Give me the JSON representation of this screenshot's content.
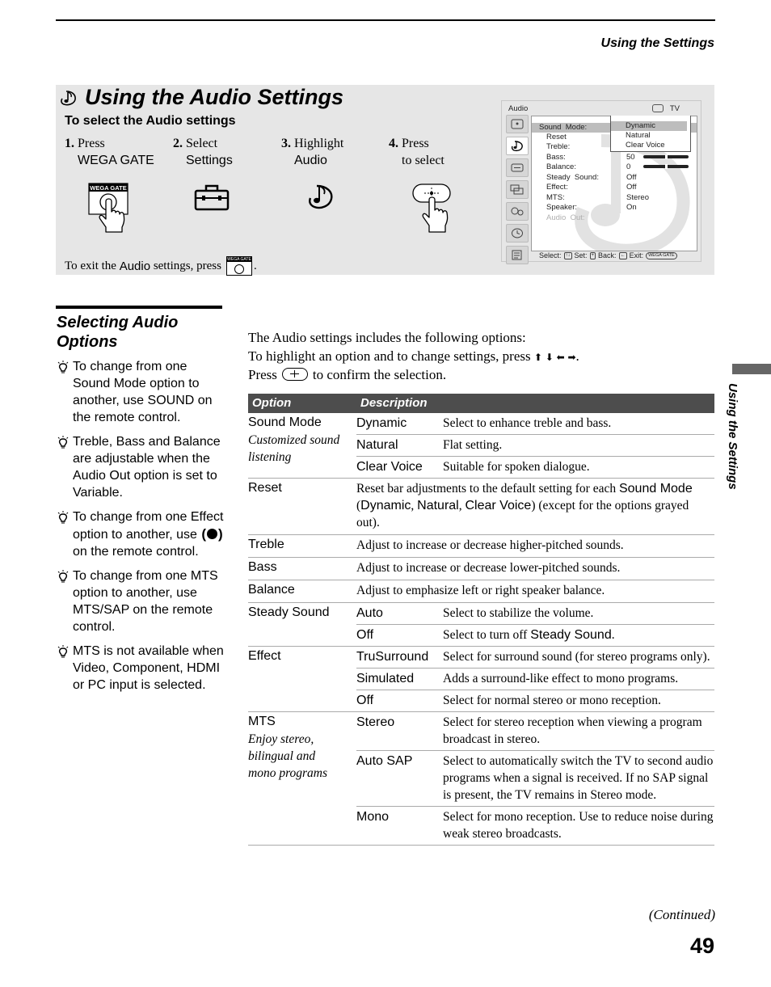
{
  "running_head": "Using the Settings",
  "side_tab_label": "Using the Settings",
  "hero": {
    "title": "Using the Audio Settings",
    "title_icon": "audio-note-icon",
    "subtitle": "To select the Audio settings",
    "steps": [
      {
        "num": "1.",
        "verb": "Press",
        "object": "WEGA GATE",
        "icon": "wega-gate-button-press-icon",
        "icon_label": "WEGA GATE"
      },
      {
        "num": "2.",
        "verb": "Select",
        "object": "Settings",
        "icon": "toolbox-icon"
      },
      {
        "num": "3.",
        "verb": "Highlight",
        "object": "Audio",
        "icon": "audio-note-icon"
      },
      {
        "num": "4.",
        "verb": "Press",
        "object": "to select",
        "icon": "select-button-press-icon"
      }
    ],
    "exit": {
      "prefix": "To exit the ",
      "word": "Audio",
      "suffix": " settings, press",
      "end": ".",
      "button_label": "WEGA GATE"
    }
  },
  "osd": {
    "header_label": "Audio",
    "input_label": "TV",
    "tabs": [
      "picture-icon",
      "audio-icon",
      "screen-icon",
      "channels-icon",
      "parent-icon",
      "timer-icon",
      "setup-icon"
    ],
    "active_tab": 1,
    "rows": [
      {
        "label": "Sound  Mode:",
        "value": ""
      },
      {
        "label": "Reset",
        "value": ""
      },
      {
        "label": "Treble:",
        "value": ""
      },
      {
        "label": "Bass:",
        "value": "50",
        "slider": 0.5
      },
      {
        "label": "Balance:",
        "value": "0",
        "slider": 0.5
      },
      {
        "label": "Steady  Sound:",
        "value": "Off"
      },
      {
        "label": "Effect:",
        "value": "Off"
      },
      {
        "label": "MTS:",
        "value": "Stereo"
      },
      {
        "label": "Speaker:",
        "value": "On"
      },
      {
        "label": "Audio  Out:",
        "value": "",
        "disabled": true
      }
    ],
    "dropdown": {
      "options": [
        "Dynamic",
        "Natural",
        "Clear Voice"
      ],
      "selected": 0
    },
    "footer": {
      "select": "Select:",
      "set": "Set:",
      "back": "Back:",
      "exit": "Exit:",
      "exit_key": "WEGA GATE"
    }
  },
  "sidebar": {
    "title": "Selecting Audio Options",
    "tips": [
      {
        "text": "To change from one Sound Mode option to another, use SOUND on the remote control."
      },
      {
        "text": "Treble, Bass and Balance are adjustable when the Audio Out option is set to Variable."
      },
      {
        "before": "To change from one Effect option to another, use",
        "after": "on the remote control."
      },
      {
        "text": "To change from one MTS option to another, use MTS/SAP on the remote control."
      },
      {
        "text": "MTS is not available when Video, Component, HDMI or PC input is selected."
      }
    ]
  },
  "intro": {
    "line1": "The Audio settings includes the following options:",
    "line2": "To highlight an option and to change settings, press ↑ ↓ ← →.",
    "line2_prefix": "To highlight an option and to change settings, press",
    "arrows": "⬆ ⬇ ⬅ ➡",
    "line3_prefix": "Press",
    "line3_suffix": "to confirm the selection."
  },
  "table": {
    "headers": [
      "Option",
      "Description"
    ],
    "groups": [
      {
        "option": "Sound Mode",
        "sub": "Customized sound listening",
        "rows": [
          {
            "value": "Dynamic",
            "desc": "Select to enhance treble and bass."
          },
          {
            "value": "Natural",
            "desc": "Flat setting."
          },
          {
            "value": "Clear Voice",
            "desc": "Suitable for spoken dialogue."
          }
        ]
      },
      {
        "option": "Reset",
        "desc_parts": [
          "Reset bar adjustments to the default setting for each ",
          "Sound Mode",
          " (",
          "Dynamic",
          ", ",
          "Natural",
          ", ",
          "Clear Voice",
          ") (except for the options grayed out)."
        ]
      },
      {
        "option": "Treble",
        "desc": "Adjust to increase or decrease higher-pitched sounds."
      },
      {
        "option": "Bass",
        "desc": "Adjust to increase or decrease lower-pitched sounds."
      },
      {
        "option": "Balance",
        "desc": "Adjust to emphasize left or right speaker balance."
      },
      {
        "option": "Steady Sound",
        "rows": [
          {
            "value": "Auto",
            "desc": "Select to stabilize the volume."
          },
          {
            "value": "Off",
            "desc_prefix": "Select to turn off ",
            "desc_sans": "Steady Sound",
            "desc_suffix": "."
          }
        ]
      },
      {
        "option": "Effect",
        "rows": [
          {
            "value": "TruSurround",
            "desc": "Select for surround sound (for stereo programs only)."
          },
          {
            "value": "Simulated",
            "desc": "Adds a surround-like effect to mono programs."
          },
          {
            "value": "Off",
            "desc": "Select for normal stereo or mono reception."
          }
        ]
      },
      {
        "option": "MTS",
        "sub": "Enjoy stereo, bilingual and mono programs",
        "rows": [
          {
            "value": "Stereo",
            "desc": "Select for stereo reception when viewing a program broadcast in stereo."
          },
          {
            "value": "Auto SAP",
            "desc": "Select to automatically switch the TV to second audio programs when a signal is received. If no SAP signal is present, the TV remains in Stereo mode."
          },
          {
            "value": "Mono",
            "desc": "Select for mono reception. Use to reduce noise during weak stereo broadcasts."
          }
        ]
      }
    ]
  },
  "footer": {
    "continued": "(Continued)",
    "page_number": "49"
  },
  "colors": {
    "hero_bg": "#e6e6e6",
    "table_header_bg": "#4d4d4d",
    "side_tab": "#666666",
    "rule": "#aaaaaa"
  }
}
